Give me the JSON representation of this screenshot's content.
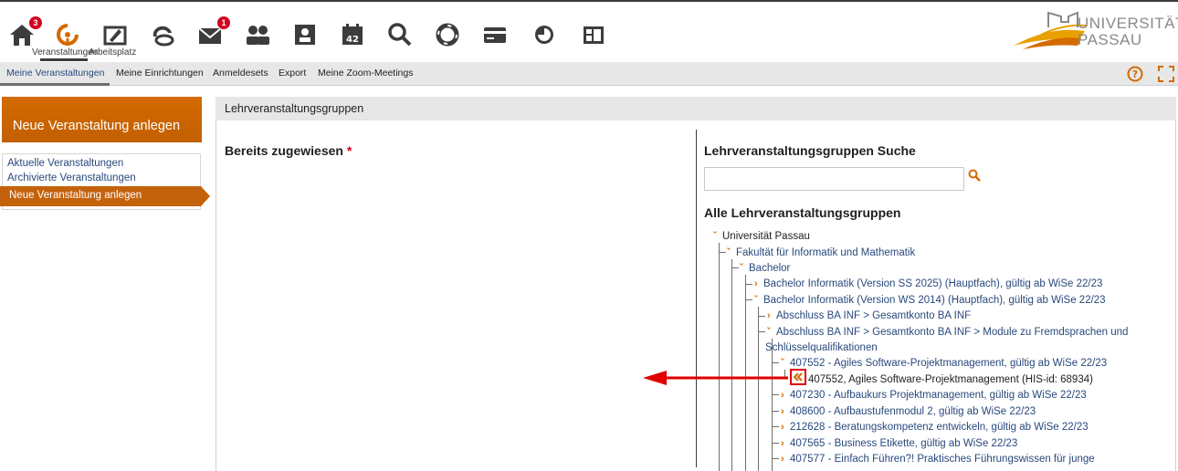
{
  "topnav": {
    "home_badge": "3",
    "mail_badge": "1",
    "label_veranstaltungen": "Veranstaltungen",
    "label_arbeitsplatz": "Arbeitsplatz",
    "logo_line1": "UNIVERSITÄT",
    "logo_line2": "PASSAU"
  },
  "tabs": [
    "Meine Veranstaltungen",
    "Meine Einrichtungen",
    "Anmeldesets",
    "Export",
    "Meine Zoom-Meetings"
  ],
  "sidebar": {
    "new_button": "Neue Veranstaltung anlegen",
    "links": [
      "Aktuelle Veranstaltungen",
      "Archivierte Veranstaltungen"
    ],
    "active": "Neue Veranstaltung anlegen"
  },
  "main": {
    "header": "Lehrveranstaltungsgruppen",
    "assigned_title": "Bereits zugewiesen",
    "required_mark": "*",
    "search_title": "Lehrveranstaltungsgruppen Suche",
    "search_value": "",
    "all_title": "Alle Lehrveranstaltungsgruppen"
  },
  "tree": {
    "n0": "Universität Passau",
    "n1": "Fakultät für Informatik und Mathematik",
    "n2": "Bachelor",
    "n3": "Bachelor Informatik (Version SS 2025) (Hauptfach), gültig ab WiSe 22/23",
    "n4": "Bachelor Informatik (Version WS 2014) (Hauptfach), gültig ab WiSe 22/23",
    "n5": "Abschluss BA INF > Gesamtkonto BA INF",
    "n6a": "Abschluss BA INF > Gesamtkonto BA INF > Module zu Fremdsprachen und",
    "n6b": "Schlüsselqualifikationen",
    "n7": "407552 - Agiles Software-Projektmanagement, gültig ab WiSe 22/23",
    "n8": "407552, Agiles Software-Projektmanagement (HIS-id: 68934)",
    "n9": "407230 - Aufbaukurs Projektmanagement, gültig ab WiSe 22/23",
    "n10": "408600 - Aufbaustufenmodul 2, gültig ab WiSe 22/23",
    "n11": "212628 - Beratungskompetenz entwickeln, gültig ab WiSe 22/23",
    "n12": "407565 - Business Etikette, gültig ab WiSe 22/23",
    "n13": "407577 - Einfach Führen?! Praktisches Führungswissen für junge"
  },
  "colors": {
    "accent_orange": "#d46a00",
    "link_blue": "#28497c",
    "badge_red": "#d1001f",
    "annotation_red": "#e00000"
  }
}
